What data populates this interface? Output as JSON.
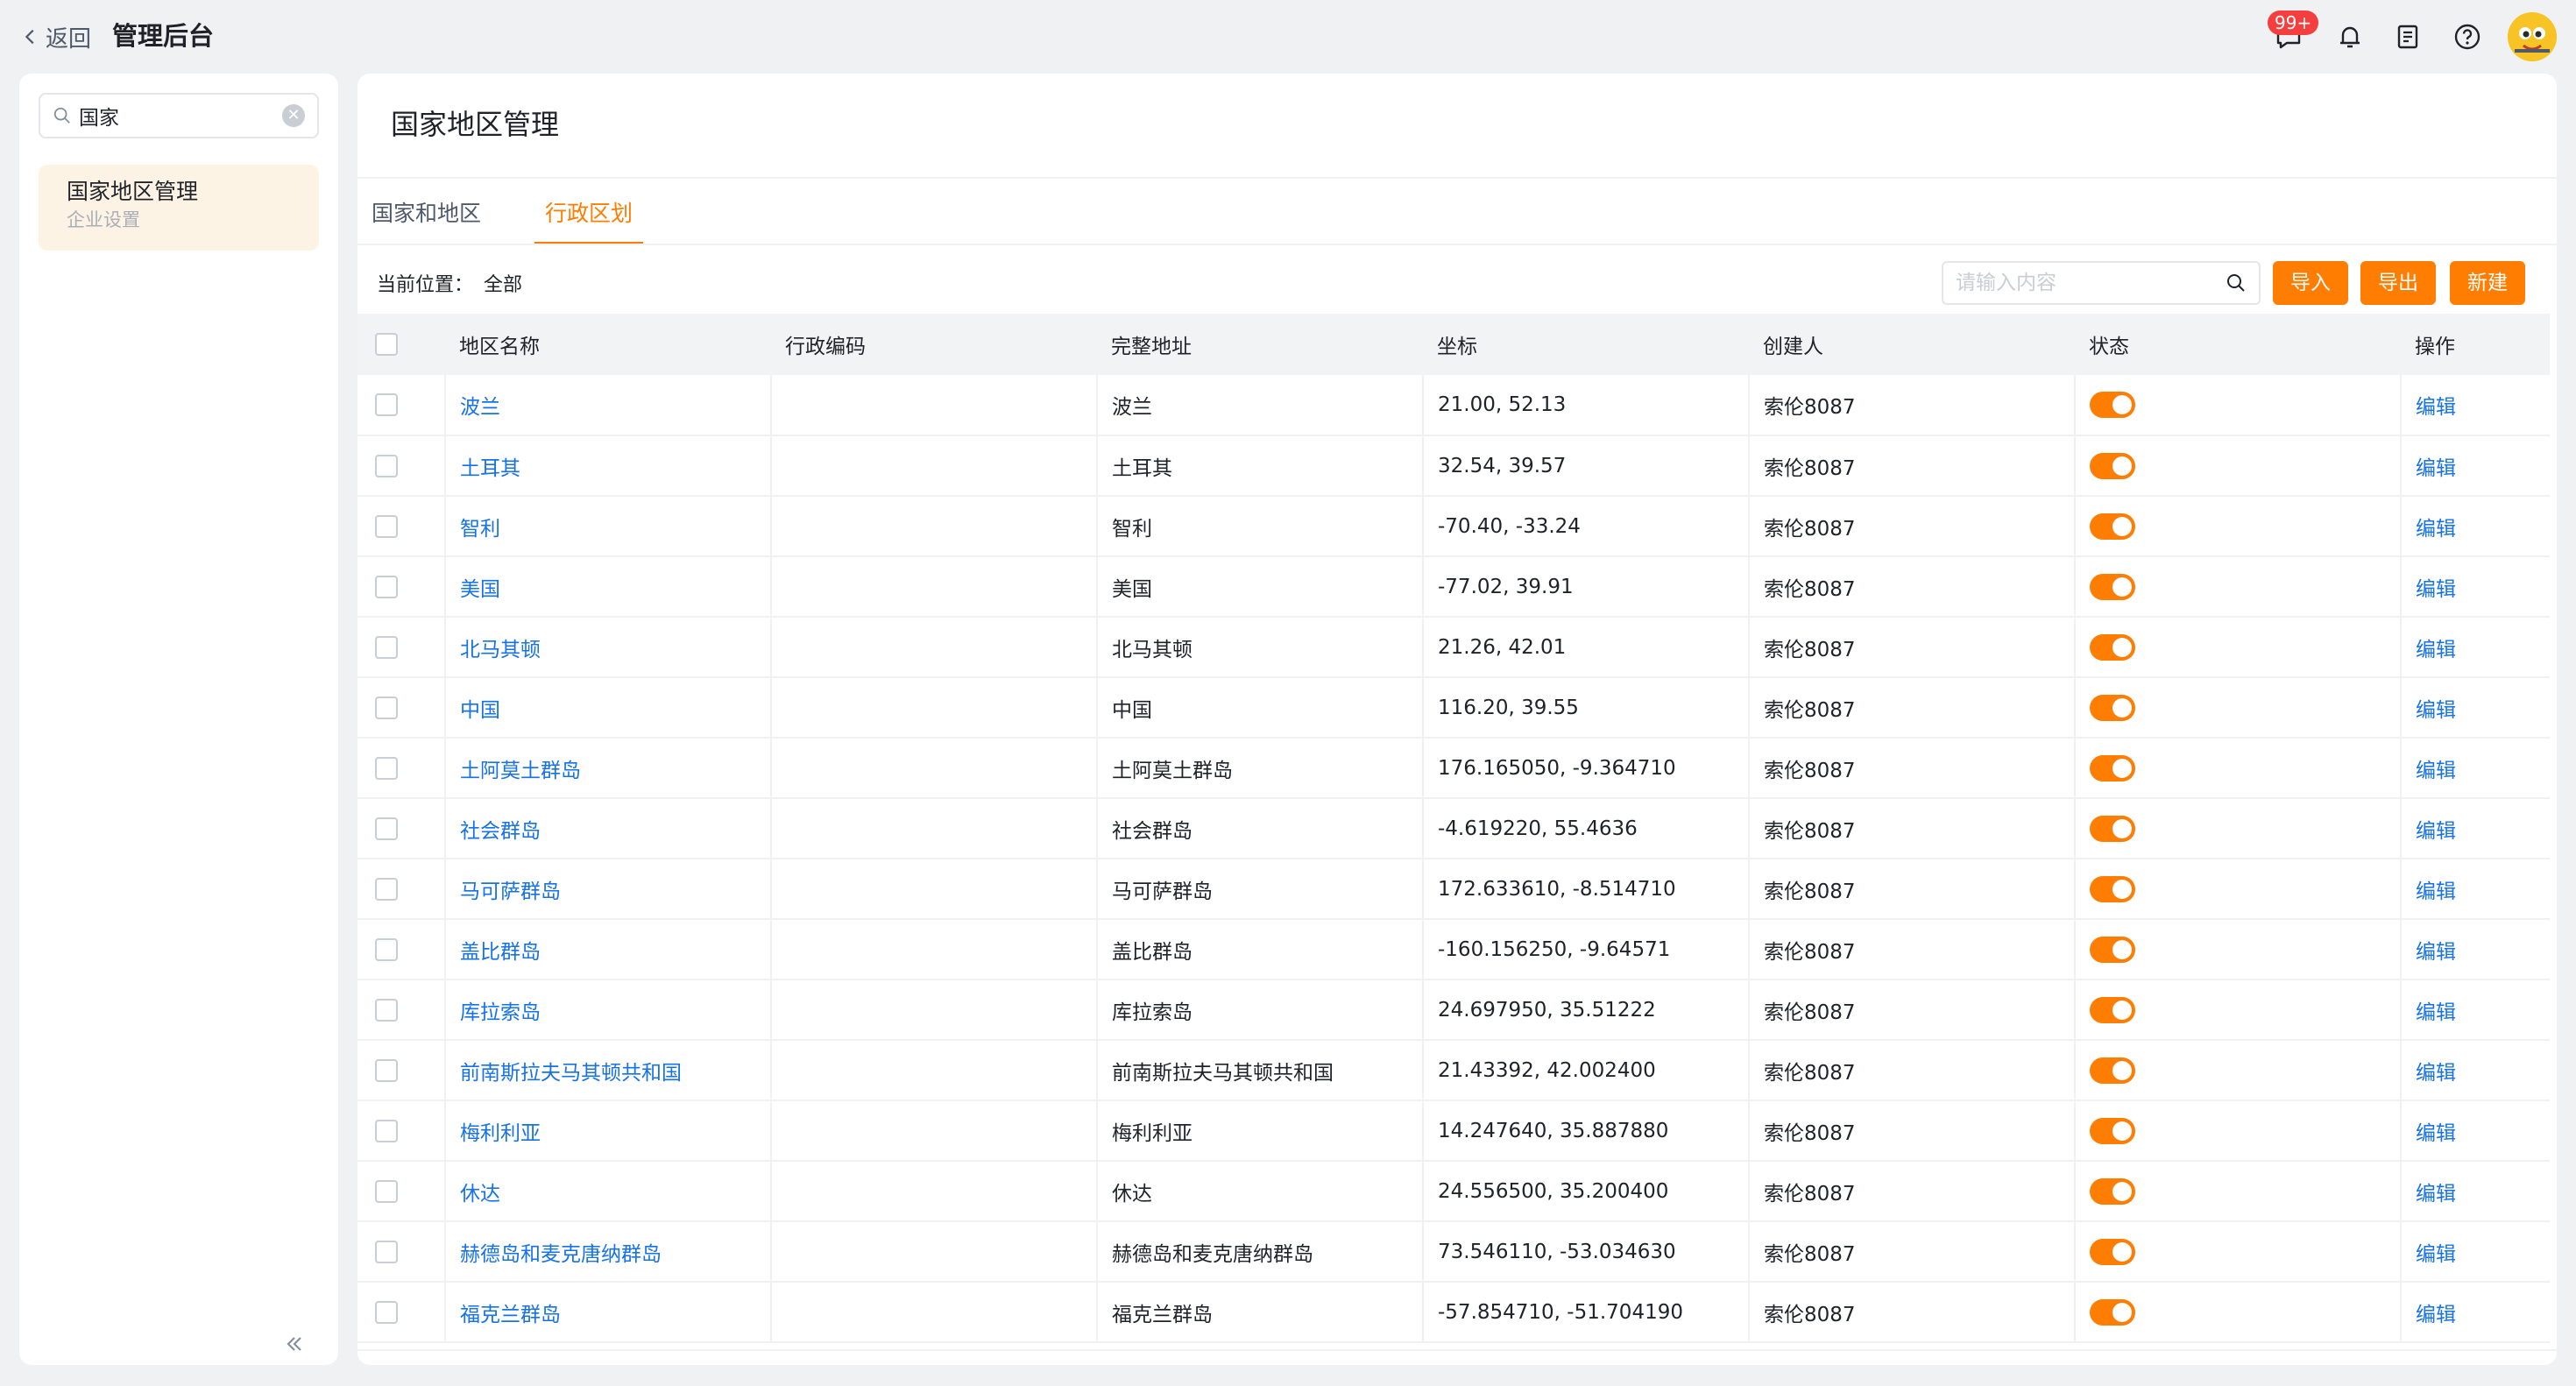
{
  "header": {
    "back_label": "返回",
    "app_title": "管理后台",
    "message_badge": "99+"
  },
  "sidebar": {
    "search_value": "国家",
    "menu_title": "国家地区管理",
    "menu_subtitle": "企业设置"
  },
  "main": {
    "page_title": "国家地区管理",
    "tabs": [
      {
        "label": "国家和地区"
      },
      {
        "label": "行政区划"
      }
    ],
    "location_label": "当前位置：",
    "location_value": "全部",
    "search_placeholder": "请输入内容",
    "buttons": {
      "import": "导入",
      "export": "导出",
      "new": "新建"
    }
  },
  "table": {
    "columns": [
      "地区名称",
      "行政编码",
      "完整地址",
      "坐标",
      "创建人",
      "状态",
      "操作"
    ],
    "edit_label": "编辑",
    "rows": [
      {
        "name": "波兰",
        "code": "",
        "address": "波兰",
        "coords": "21.00, 52.13",
        "creator": "索伦8087",
        "enabled": true
      },
      {
        "name": "土耳其",
        "code": "",
        "address": "土耳其",
        "coords": "32.54, 39.57",
        "creator": "索伦8087",
        "enabled": true
      },
      {
        "name": "智利",
        "code": "",
        "address": "智利",
        "coords": "-70.40, -33.24",
        "creator": "索伦8087",
        "enabled": true
      },
      {
        "name": "美国",
        "code": "",
        "address": "美国",
        "coords": "-77.02, 39.91",
        "creator": "索伦8087",
        "enabled": true
      },
      {
        "name": "北马其顿",
        "code": "",
        "address": "北马其顿",
        "coords": "21.26, 42.01",
        "creator": "索伦8087",
        "enabled": true
      },
      {
        "name": "中国",
        "code": "",
        "address": "中国",
        "coords": "116.20, 39.55",
        "creator": "索伦8087",
        "enabled": true
      },
      {
        "name": "土阿莫土群岛",
        "code": "",
        "address": "土阿莫土群岛",
        "coords": "176.165050, -9.364710",
        "creator": "索伦8087",
        "enabled": true
      },
      {
        "name": "社会群岛",
        "code": "",
        "address": "社会群岛",
        "coords": "-4.619220, 55.4636",
        "creator": "索伦8087",
        "enabled": true
      },
      {
        "name": "马可萨群岛",
        "code": "",
        "address": "马可萨群岛",
        "coords": "172.633610, -8.514710",
        "creator": "索伦8087",
        "enabled": true
      },
      {
        "name": "盖比群岛",
        "code": "",
        "address": "盖比群岛",
        "coords": "-160.156250, -9.64571",
        "creator": "索伦8087",
        "enabled": true
      },
      {
        "name": "库拉索岛",
        "code": "",
        "address": "库拉索岛",
        "coords": "24.697950, 35.51222",
        "creator": "索伦8087",
        "enabled": true
      },
      {
        "name": "前南斯拉夫马其顿共和国",
        "code": "",
        "address": "前南斯拉夫马其顿共和国",
        "coords": "21.43392, 42.002400",
        "creator": "索伦8087",
        "enabled": true
      },
      {
        "name": "梅利利亚",
        "code": "",
        "address": "梅利利亚",
        "coords": "14.247640, 35.887880",
        "creator": "索伦8087",
        "enabled": true
      },
      {
        "name": "休达",
        "code": "",
        "address": "休达",
        "coords": "24.556500, 35.200400",
        "creator": "索伦8087",
        "enabled": true
      },
      {
        "name": "赫德岛和麦克唐纳群岛",
        "code": "",
        "address": "赫德岛和麦克唐纳群岛",
        "coords": "73.546110, -53.034630",
        "creator": "索伦8087",
        "enabled": true
      },
      {
        "name": "福克兰群岛",
        "code": "",
        "address": "福克兰群岛",
        "coords": "-57.854710, -51.704190",
        "creator": "索伦8087",
        "enabled": true
      }
    ]
  },
  "colors": {
    "accent": "#ff7d00",
    "link": "#1672e6",
    "badge": "#f53f3f",
    "menu_active_bg": "#fdf3e4"
  },
  "icons": [
    "chevron-left-icon",
    "message-icon",
    "bell-icon",
    "document-icon",
    "help-icon",
    "avatar",
    "search-icon",
    "clear-icon",
    "collapse-icon"
  ]
}
